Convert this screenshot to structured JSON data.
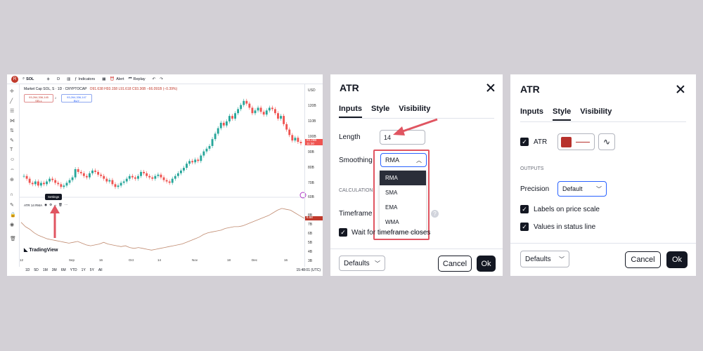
{
  "chart_panel": {
    "toolbar": {
      "avatar": "R",
      "symbol": "SOL",
      "add": "+",
      "interval": "D",
      "indicators": "Indicators",
      "alert": "Alert",
      "replay": "Replay"
    },
    "legend": {
      "title": "Market Cap SOL, S · 1D · CRYPTOCAP",
      "ohlc": "O91.638 H93.158 L91.618 C93.36B −66.091B (−0.39%)"
    },
    "sell": {
      "price": "93,264,336,145",
      "label": "SELL"
    },
    "buy": {
      "price": "93,264,336,147",
      "label": "BUY"
    },
    "price_axis": [
      "USD",
      "120B",
      "110B",
      "100B",
      "90B",
      "80B",
      "70B",
      "60B"
    ],
    "price_tag": {
      "value": "93.26B",
      "time": "11:30"
    },
    "atr_axis": [
      "8B",
      "7B",
      "6B",
      "5B",
      "4B",
      "3B"
    ],
    "atr_tag": "6.88",
    "atr_legend": "ATR 14 RMA",
    "settings_tip": "Settings",
    "logo": "TradingView",
    "time_axis": [
      "12",
      "Sep",
      "16",
      "Oct",
      "14",
      "Nov",
      "18",
      "Dec",
      "16"
    ],
    "ranges": [
      "1D",
      "5D",
      "1M",
      "3M",
      "6M",
      "YTD",
      "1Y",
      "5Y",
      "All"
    ],
    "clock": "15:48:01 (UTC)",
    "colors": {
      "up": "#26a69a",
      "down": "#ef5350",
      "atr": "#c08a6f",
      "arrow": "#e05561"
    },
    "chart_data": {
      "type": "line",
      "title": "Market Cap SOL",
      "ylabel": "USD",
      "ylim": [
        55,
        128
      ],
      "close_series": [
        68,
        66,
        63,
        62,
        64,
        61,
        63,
        62,
        64,
        66,
        65,
        63,
        62,
        60,
        61,
        63,
        65,
        67,
        73,
        71,
        70,
        68,
        67,
        70,
        72,
        71,
        69,
        68,
        66,
        64,
        65,
        62,
        60,
        61,
        63,
        64,
        66,
        68,
        67,
        66,
        68,
        71,
        70,
        68,
        67,
        66,
        68,
        69,
        67,
        65,
        64,
        63,
        66,
        68,
        70,
        72,
        74,
        77,
        79,
        78,
        80,
        79,
        83,
        86,
        88,
        90,
        95,
        99,
        103,
        107,
        105,
        108,
        112,
        110,
        114,
        117,
        120,
        123,
        121,
        118,
        114,
        116,
        118,
        115,
        113,
        116,
        118,
        117,
        114,
        110,
        112,
        106,
        102,
        98,
        94,
        96,
        93,
        92
      ],
      "atr_series": [
        6.5,
        6.0,
        5.7,
        5.3,
        5.0,
        4.8,
        4.6,
        4.5,
        4.4,
        4.3,
        4.2,
        4.1,
        4.2,
        4.3,
        4.1,
        3.9,
        3.8,
        3.9,
        4.0,
        4.2,
        4.0,
        3.9,
        3.8,
        3.7,
        3.8,
        3.6,
        3.5,
        3.6,
        3.5,
        3.4,
        3.3,
        3.4,
        3.5,
        3.6,
        3.7,
        3.8,
        3.9,
        4.0,
        4.2,
        4.4,
        4.6,
        4.8,
        5.1,
        5.3,
        5.4,
        5.5,
        5.6,
        5.8,
        5.9,
        6.0,
        6.0,
        6.1,
        6.3,
        6.5,
        6.7,
        6.9,
        7.1,
        7.3,
        7.6,
        7.9,
        8.1,
        8.0,
        7.9,
        7.6,
        7.3,
        7.0,
        6.9
      ]
    }
  },
  "dialog_inputs": {
    "title": "ATR",
    "tabs": [
      "Inputs",
      "Style",
      "Visibility"
    ],
    "length_label": "Length",
    "length_value": "14",
    "smoothing_label": "Smoothing",
    "smoothing_value": "RMA",
    "smoothing_options": [
      "RMA",
      "SMA",
      "EMA",
      "WMA"
    ],
    "section_calc": "CALCULATION",
    "timeframe_label": "Timeframe",
    "wait_label": "Wait for timeframe closes",
    "defaults": "Defaults",
    "cancel": "Cancel",
    "ok": "Ok"
  },
  "dialog_style": {
    "title": "ATR",
    "tabs": [
      "Inputs",
      "Style",
      "Visibility"
    ],
    "atr_label": "ATR",
    "line_color": "#b7312c",
    "section_outputs": "OUTPUTS",
    "precision_label": "Precision",
    "precision_value": "Default",
    "labels_price": "Labels on price scale",
    "values_status": "Values in status line",
    "defaults": "Defaults",
    "cancel": "Cancel",
    "ok": "Ok"
  }
}
